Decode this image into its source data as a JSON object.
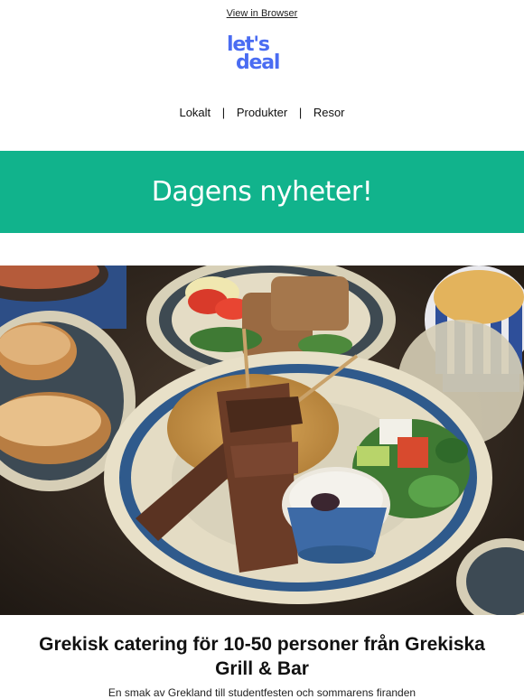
{
  "header": {
    "view_in_browser": "View in Browser",
    "logo_line1": "let's",
    "logo_line2": "deal",
    "brand_color": "#4a6cf2"
  },
  "nav": {
    "items": [
      "Lokalt",
      "Produkter",
      "Resor"
    ],
    "separator": "|"
  },
  "banner": {
    "title": "Dagens nyheter!",
    "color": "#11b38c"
  },
  "deal": {
    "image": "greek-food-platter",
    "title": "Grekisk catering för 10-50 personer från Grekiska Grill & Bar",
    "subtitle": "En smak av Grekland till studentfesten och sommarens firanden"
  }
}
